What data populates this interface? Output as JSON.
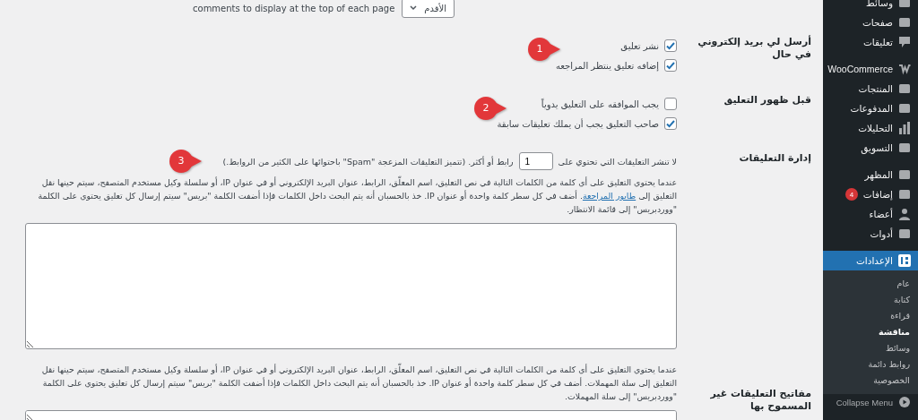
{
  "top_setting": {
    "select_value": "الأقدم",
    "text": "comments to display at the top of each page"
  },
  "settings": [
    {
      "kind": "checkboxes",
      "label": "أرسل لي بريد إلكتروني في حال",
      "callout": "1",
      "options": [
        {
          "label": "نشر تعليق",
          "checked": true
        },
        {
          "label": "إضافه تعليق ينتظر المراجعه",
          "checked": true
        }
      ]
    },
    {
      "kind": "checkboxes",
      "label": "قبل ظهور التعليق",
      "callout": "2",
      "options": [
        {
          "label": "يجب الموافقه على التعليق يدوياً",
          "checked": false
        },
        {
          "label": "صاحب التعليق يجب أن يملك تعليقات سابقة",
          "checked": true
        }
      ]
    },
    {
      "kind": "moderation",
      "label": "إدارة التعليقات",
      "callout": "3",
      "before": "لا تنشر التعليقات التي تحتوي على",
      "value": "1",
      "after": "رابط أو أكثر. (تتميز التعليقات المزعجة \"Spam\" باحتوائها على الكثير من الروابط.)",
      "description_before": "عندما يحتوي التعليق على أي كلمة من الكلمات التالية في نص التعليق، اسم المعلّق، الرابط، عنوان البريد الإلكتروني أو في عنوان IP، أو سلسلة وكيل مستخدم المتصفح، سيتم حينها نقل التعليق إلى",
      "link": "طابور المراجعة",
      "description_after": ". أضف في كل سطر كلمة واحدة أو عنوان IP. خذ بالحسبان أنه يتم البحث داخل الكلمات فإذا أضفت الكلمة \"بريس\" سيتم إرسال كل تعليق يحتوي على الكلمة \"ووردبريس\" إلى قائمة الانتظار."
    },
    {
      "kind": "disallowed",
      "label": "مفاتيح التعليقات غير المسموح بها",
      "description_before": "عندما يحتوي التعليق على أي كلمة من الكلمات التالية في نص التعليق، اسم المعلّق، الرابط، عنوان البريد الإلكتروني أو في عنوان IP، أو سلسلة وكيل مستخدم المتصفح، سيتم حينها نقل التعليق إلى سلة المهملات. أضف في كل سطر كلمة واحدة أو عنوان IP. خذ بالحسبان أنه يتم البحث داخل الكلمات فإذا أضفت الكلمة \"بريس\" سيتم إرسال كل تعليق يحتوي على الكلمة \"ووردبريس\" إلى سلة المهملات."
    }
  ],
  "sidebar": {
    "items": [
      {
        "label": "وسائط",
        "selected": false
      },
      {
        "label": "صفحات",
        "selected": false
      },
      {
        "label": "تعليقات",
        "selected": false
      },
      {
        "label": "WooCommerce",
        "selected": false
      },
      {
        "label": "المنتجات",
        "selected": false
      },
      {
        "label": "المدفوعات",
        "selected": false
      },
      {
        "label": "التحليلات",
        "selected": false
      },
      {
        "label": "التسويق",
        "selected": false
      },
      {
        "label": "المظهر",
        "selected": false
      },
      {
        "label": "إضافات",
        "selected": false,
        "badge": "4"
      },
      {
        "label": "أعضاء",
        "selected": false
      },
      {
        "label": "أدوات",
        "selected": false
      },
      {
        "label": "الإعدادات",
        "selected": true
      }
    ],
    "submenu": [
      {
        "label": "عام",
        "selected": false
      },
      {
        "label": "كتابة",
        "selected": false
      },
      {
        "label": "قراءة",
        "selected": false
      },
      {
        "label": "مناقشة",
        "selected": true
      },
      {
        "label": "وسائط",
        "selected": false
      },
      {
        "label": "روابط دائمة",
        "selected": false
      },
      {
        "label": "الخصوصية",
        "selected": false
      }
    ],
    "collapse": "Collapse Menu"
  }
}
